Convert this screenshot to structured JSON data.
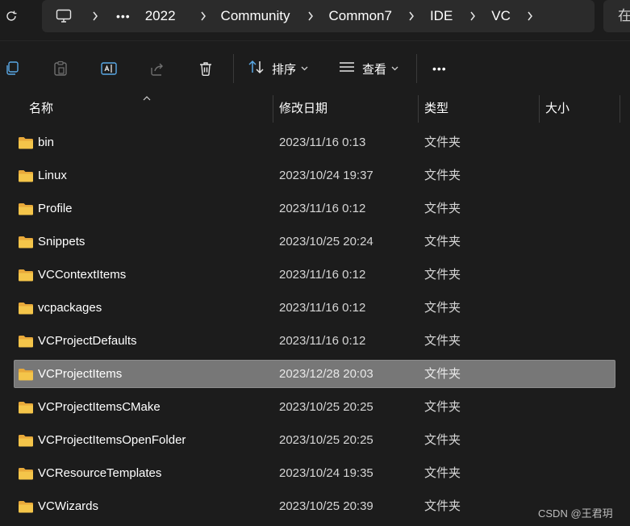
{
  "breadcrumbs": [
    "•••",
    "2022",
    "Community",
    "Common7",
    "IDE",
    "VC"
  ],
  "search_stub": "在",
  "toolbar": {
    "sort_label": "排序",
    "view_label": "查看",
    "more_label": "•••"
  },
  "columns": {
    "name": "名称",
    "modified": "修改日期",
    "type": "类型",
    "size": "大小"
  },
  "rows": [
    {
      "name": "bin",
      "modified": "2023/11/16 0:13",
      "type": "文件夹"
    },
    {
      "name": "Linux",
      "modified": "2023/10/24 19:37",
      "type": "文件夹"
    },
    {
      "name": "Profile",
      "modified": "2023/11/16 0:12",
      "type": "文件夹"
    },
    {
      "name": "Snippets",
      "modified": "2023/10/25 20:24",
      "type": "文件夹"
    },
    {
      "name": "VCContextItems",
      "modified": "2023/11/16 0:12",
      "type": "文件夹"
    },
    {
      "name": "vcpackages",
      "modified": "2023/11/16 0:12",
      "type": "文件夹"
    },
    {
      "name": "VCProjectDefaults",
      "modified": "2023/11/16 0:12",
      "type": "文件夹"
    },
    {
      "name": "VCProjectItems",
      "modified": "2023/12/28 20:03",
      "type": "文件夹",
      "selected": true
    },
    {
      "name": "VCProjectItemsCMake",
      "modified": "2023/10/25 20:25",
      "type": "文件夹"
    },
    {
      "name": "VCProjectItemsOpenFolder",
      "modified": "2023/10/25 20:25",
      "type": "文件夹"
    },
    {
      "name": "VCResourceTemplates",
      "modified": "2023/10/24 19:35",
      "type": "文件夹"
    },
    {
      "name": "VCWizards",
      "modified": "2023/10/25 20:39",
      "type": "文件夹"
    }
  ],
  "watermark": "CSDN @王君玥",
  "colors": {
    "background": "#1c1c1c",
    "selection": "#777777",
    "folder": "#f4c54a",
    "addressbar": "#2b2b2b"
  }
}
